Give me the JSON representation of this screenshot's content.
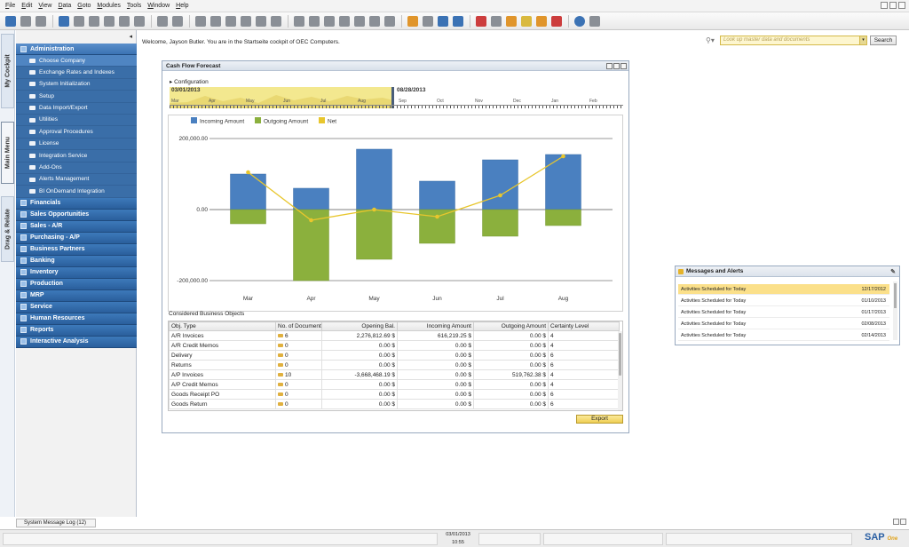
{
  "menubar": {
    "items": [
      {
        "u": "F",
        "rest": "ile"
      },
      {
        "u": "E",
        "rest": "dit"
      },
      {
        "u": "V",
        "rest": "iew"
      },
      {
        "u": "D",
        "rest": "ata"
      },
      {
        "u": "G",
        "rest": "oto"
      },
      {
        "u": "M",
        "rest": "odules"
      },
      {
        "u": "T",
        "rest": "ools"
      },
      {
        "u": "W",
        "rest": "indow"
      },
      {
        "u": "H",
        "rest": "elp"
      }
    ]
  },
  "side_tabs": {
    "cockpit": "My Cockpit",
    "main_menu": "Main Menu",
    "drag_relate": "Drag & Relate"
  },
  "leftpanel": {
    "collapse_glyph": "◂",
    "administration": "Administration",
    "admin_items": [
      "Choose Company",
      "Exchange Rates and Indexes",
      "System Initialization",
      "Setup",
      "Data Import/Export",
      "Utilities",
      "Approval Procedures",
      "License",
      "Integration Service",
      "Add-Ons",
      "Alerts Management",
      "BI OnDemand Integration"
    ],
    "modules": [
      "Financials",
      "Sales Opportunities",
      "Sales - A/R",
      "Purchasing - A/P",
      "Business Partners",
      "Banking",
      "Inventory",
      "Production",
      "MRP",
      "Service",
      "Human Resources",
      "Reports",
      "Interactive Analysis"
    ]
  },
  "welcome": "Welcome, Jayson Butler. You are in the Startseite cockpit of OEC Computers.",
  "search": {
    "placeholder": "Look up master data and documents",
    "button": "Search",
    "icon": "search-icon"
  },
  "cashflow": {
    "title": "Cash Flow Forecast",
    "configuration": "Configuration",
    "timeline": {
      "start_date": "03/01/2013",
      "end_date": "08/28/2013",
      "selected_months": [
        "Mar",
        "Apr",
        "May",
        "Jun",
        "Jul",
        "Aug"
      ],
      "future_months": [
        "Sep",
        "Oct",
        "Nov",
        "Dec",
        "Jan",
        "Feb"
      ]
    },
    "considered_title": "Considered Business Objects",
    "columns": [
      "Obj. Type",
      "No. of Document",
      "Opening Bal.",
      "Incoming Amount",
      "Outgoing Amount",
      "Certainty Level"
    ],
    "rows": [
      {
        "type": "A/R Invoices",
        "docs": "6",
        "opening": "2,276,812.69 $",
        "incoming": "616,219.25 $",
        "outgoing": "0.00 $",
        "certainty": "4"
      },
      {
        "type": "A/R Credit Memos",
        "docs": "0",
        "opening": "0.00 $",
        "incoming": "0.00 $",
        "outgoing": "0.00 $",
        "certainty": "4"
      },
      {
        "type": "Delivery",
        "docs": "0",
        "opening": "0.00 $",
        "incoming": "0.00 $",
        "outgoing": "0.00 $",
        "certainty": "6"
      },
      {
        "type": "Returns",
        "docs": "0",
        "opening": "0.00 $",
        "incoming": "0.00 $",
        "outgoing": "0.00 $",
        "certainty": "6"
      },
      {
        "type": "A/P Invoices",
        "docs": "10",
        "opening": "-3,668,468.19 $",
        "incoming": "0.00 $",
        "outgoing": "519,762.38 $",
        "certainty": "4"
      },
      {
        "type": "A/P Credit Memos",
        "docs": "0",
        "opening": "0.00 $",
        "incoming": "0.00 $",
        "outgoing": "0.00 $",
        "certainty": "4"
      },
      {
        "type": "Goods Receipt PO",
        "docs": "0",
        "opening": "0.00 $",
        "incoming": "0.00 $",
        "outgoing": "0.00 $",
        "certainty": "6"
      },
      {
        "type": "Goods Return",
        "docs": "0",
        "opening": "0.00 $",
        "incoming": "0.00 $",
        "outgoing": "0.00 $",
        "certainty": "6"
      }
    ],
    "export_button": "Export"
  },
  "chart_data": {
    "type": "bar",
    "categories": [
      "Mar",
      "Apr",
      "May",
      "Jun",
      "Jul",
      "Aug"
    ],
    "series": [
      {
        "name": "Incoming Amount",
        "type": "bar",
        "color": "#4a80c0",
        "values": [
          100000,
          60000,
          170000,
          80000,
          140000,
          155000
        ]
      },
      {
        "name": "Outgoing Amount",
        "type": "bar",
        "color": "#8bb03d",
        "values": [
          -40000,
          -200000,
          -140000,
          -95000,
          -75000,
          -45000
        ]
      },
      {
        "name": "Net",
        "type": "line",
        "color": "#e8c62d",
        "values": [
          105000,
          -30000,
          0,
          -20000,
          40000,
          150000
        ]
      }
    ],
    "legend": [
      "Incoming Amount",
      "Outgoing Amount",
      "Net"
    ],
    "y_ticks": [
      "200,000.00",
      "0.00",
      "-200,000.00"
    ],
    "ylim": [
      -230000,
      230000
    ],
    "legend_position": "top-left"
  },
  "messages": {
    "title": "Messages and Alerts",
    "rows": [
      {
        "text": "Activities Scheduled for Today",
        "date": "12/17/2012"
      },
      {
        "text": "Activities Scheduled for Today",
        "date": "01/10/2013"
      },
      {
        "text": "Activities Scheduled for Today",
        "date": "01/17/2013"
      },
      {
        "text": "Activities Scheduled for Today",
        "date": "02/08/2013"
      },
      {
        "text": "Activities Scheduled for Today",
        "date": "02/14/2013"
      }
    ]
  },
  "status": {
    "system_message_log": "System Message Log (12)",
    "date": "03/01/2013",
    "time": "10:55",
    "logo": "SAP",
    "logo_sub": "One"
  }
}
